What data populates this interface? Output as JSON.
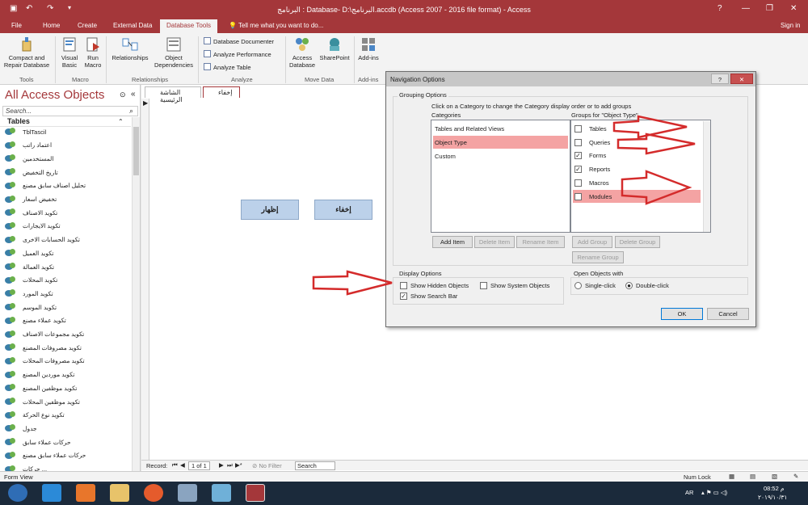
{
  "window": {
    "title": "البرنامج : Database- D:\\البرنامج.accdb (Access 2007 - 2016 file format) - Access",
    "help": "?",
    "sign_in": "Sign in",
    "controls": {
      "minimize": "—",
      "restore": "❐",
      "close": "✕"
    }
  },
  "menu": {
    "tabs": [
      "File",
      "Home",
      "Create",
      "External Data",
      "Database Tools"
    ],
    "tell_me": "Tell me what you want to do..."
  },
  "ribbon": {
    "buttons": {
      "compact": "Compact and Repair Database",
      "visual_basic": "Visual Basic",
      "run_macro": "Run Macro",
      "relationships": "Relationships",
      "object_dependencies": "Object Dependencies",
      "db_documenter": "Database Documenter",
      "analyze_performance": "Analyze Performance",
      "analyze_table": "Analyze Table",
      "access_database": "Access Database",
      "sharepoint": "SharePoint",
      "addins": "Add-ins"
    },
    "groups": {
      "tools": "Tools",
      "macro": "Macro",
      "relationships": "Relationships",
      "analyze": "Analyze",
      "move_data": "Move Data",
      "addins": "Add-ins"
    }
  },
  "nav": {
    "title": "All Access Objects",
    "search_placeholder": "Search...",
    "section": "Tables",
    "items": [
      "TblTascil",
      "اعتماد راتب",
      "المستخدمين",
      "تاريخ التخفيض",
      "تحليل اصناف سابق مصنع",
      "تخفيض اسعار",
      "تكويد الاصناف",
      "تكويد الايجارات",
      "تكويد الحسابات الاخرى",
      "تكويد العميل",
      "تكويد العمالة",
      "تكويد المحلات",
      "تكويد المورد",
      "تكويد الموسم",
      "تكويد عملاء مصنع",
      "تكويد مجموعات الاصناف",
      "تكويد مصروفات المصنع",
      "تكويد مصروفات المحلات",
      "تكويد موردين المصنع",
      "تكويد موظفين المصنع",
      "تكويد موظفين المحلات",
      "تكويد نوع الحركة",
      "جدول",
      "حركات عملاء سابق",
      "حركات عملاء سابق مصنع",
      "حركات ..."
    ]
  },
  "document": {
    "tabs": [
      "الشاشة الرئيسية",
      "إخفاء"
    ],
    "show_button": "إظهار",
    "hide_button": "إخفاء"
  },
  "record_bar": {
    "label": "Record:",
    "position": "1 of 1",
    "filter": "No Filter",
    "search": "Search"
  },
  "status_bar": {
    "left": "Form View",
    "num_lock": "Num Lock"
  },
  "dialog": {
    "title": "Navigation Options",
    "help": "?",
    "close": "✕",
    "grouping_label": "Grouping Options",
    "instruction": "Click on a Category to change the Category display order or to add groups",
    "categories_label": "Categories",
    "groups_label": "Groups for \"Object Type\"",
    "categories": [
      "Tables and Related Views",
      "Object Type",
      "Custom"
    ],
    "selected_category": 1,
    "groups": [
      {
        "label": "Tables",
        "checked": false
      },
      {
        "label": "Queries",
        "checked": false
      },
      {
        "label": "Forms",
        "checked": true
      },
      {
        "label": "Reports",
        "checked": true
      },
      {
        "label": "Macros",
        "checked": false
      },
      {
        "label": "Modules",
        "checked": false
      }
    ],
    "buttons": {
      "add_item": "Add Item",
      "delete_item": "Delete Item",
      "rename_item": "Rename Item",
      "add_group": "Add Group",
      "delete_group": "Delete Group",
      "rename_group": "Rename Group",
      "ok": "OK",
      "cancel": "Cancel"
    },
    "display_label": "Display Options",
    "show_hidden": "Show Hidden Objects",
    "show_system": "Show System Objects",
    "show_search": "Show Search Bar",
    "show_hidden_checked": false,
    "show_system_checked": false,
    "show_search_checked": true,
    "open_label": "Open Objects with",
    "single_click": "Single-click",
    "double_click": "Double-click",
    "open_mode": "double"
  },
  "taskbar": {
    "lang": "AR",
    "time": "08:52 م",
    "date": "٢٠١٩/١٠/٣١"
  },
  "colors": {
    "accent": "#a4373a",
    "selection": "#f4a3a3",
    "arrow": "#d42b2b"
  }
}
